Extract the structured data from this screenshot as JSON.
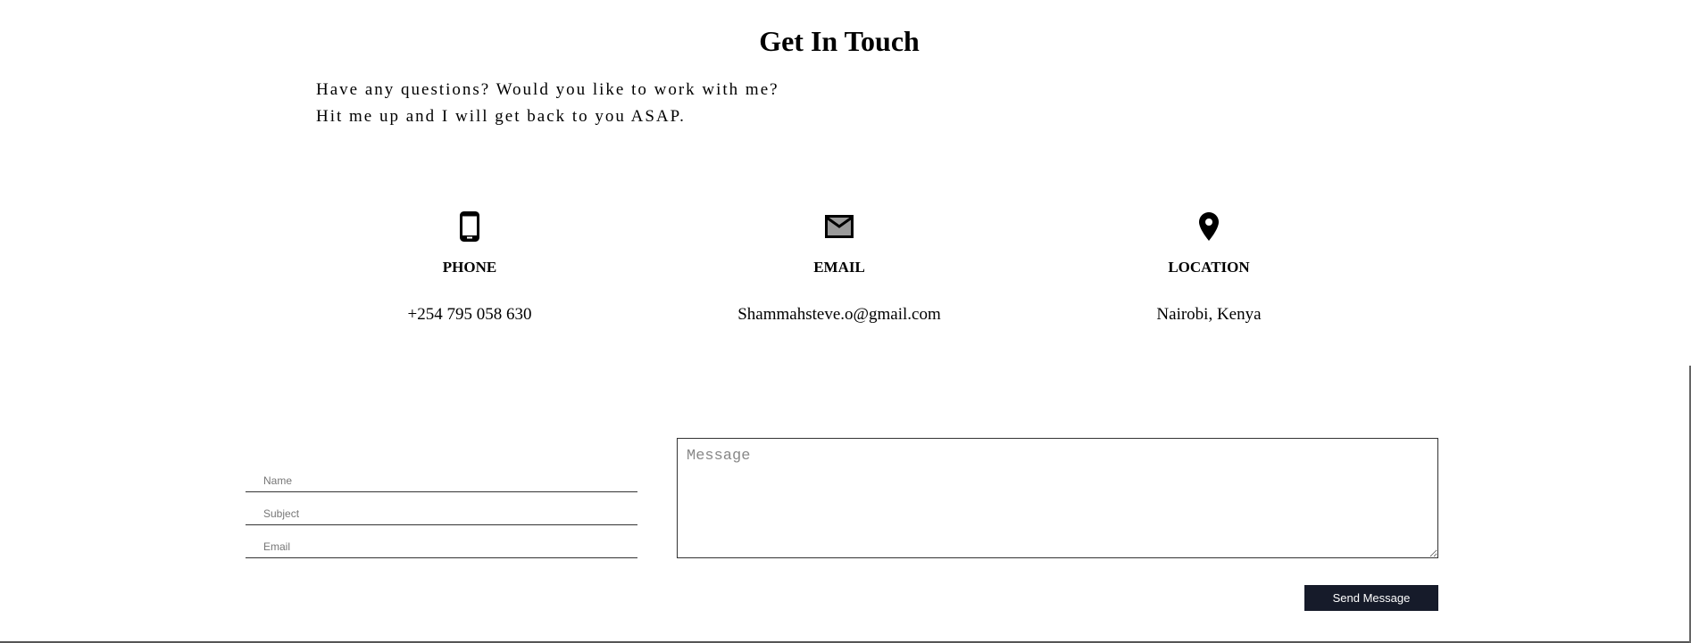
{
  "section": {
    "title": "Get In Touch",
    "intro_lines": [
      "Have any questions? Would you like to work with me?",
      "Hit me up and I will get back to you ASAP."
    ]
  },
  "contacts": [
    {
      "icon": "phone-icon",
      "label": "PHONE",
      "value": "+254 795 058 630"
    },
    {
      "icon": "envelope-icon",
      "label": "EMAIL",
      "value": "Shammahsteve.o@gmail.com"
    },
    {
      "icon": "map-pin-icon",
      "label": "LOCATION",
      "value": "Nairobi, Kenya"
    }
  ],
  "form": {
    "name_placeholder": "Name",
    "subject_placeholder": "Subject",
    "email_placeholder": "Email",
    "message_placeholder": "Message",
    "submit_label": "Send Message"
  },
  "colors": {
    "button_background": "#161b2a",
    "button_text": "#ffffff",
    "text": "#000000"
  }
}
